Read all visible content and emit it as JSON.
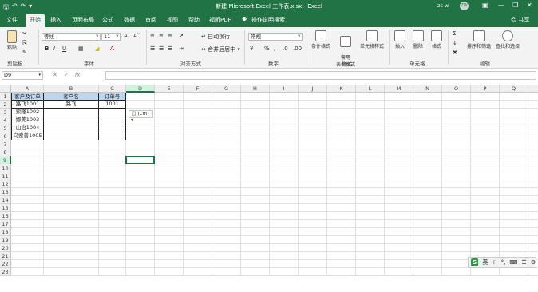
{
  "titlebar": {
    "doc_title": "新建 Microsoft Excel 工作表.xlsx  -  Excel",
    "user": "zc w",
    "avatar": "ZW",
    "qat": [
      "save-icon",
      "undo-icon",
      "redo-icon",
      "customize-icon"
    ],
    "controls": [
      "ribbon-display-icon",
      "minimize-icon",
      "restore-icon",
      "close-icon"
    ]
  },
  "tabs": [
    {
      "label": "文件",
      "active": false
    },
    {
      "label": "开始",
      "active": true
    },
    {
      "label": "插入",
      "active": false
    },
    {
      "label": "页面布局",
      "active": false
    },
    {
      "label": "公式",
      "active": false
    },
    {
      "label": "数据",
      "active": false
    },
    {
      "label": "审阅",
      "active": false
    },
    {
      "label": "视图",
      "active": false
    },
    {
      "label": "帮助",
      "active": false
    },
    {
      "label": "福昕PDF",
      "active": false
    }
  ],
  "tell_me": "操作说明搜索",
  "share": "共享",
  "ribbon": {
    "groups": [
      "剪贴板",
      "字体",
      "对齐方式",
      "数字",
      "样式",
      "单元格",
      "编辑"
    ],
    "paste": "粘贴",
    "font_name": "等线",
    "font_size": "11",
    "wrap_text": "自动换行",
    "merge_center": "合并后居中",
    "number_format": "常规",
    "conditional_format": "条件格式",
    "format_as_table": "套用\n表格格式",
    "cell_styles": "单元格样式",
    "insert": "插入",
    "delete": "删除",
    "format": "格式",
    "sort_filter": "排序和筛选",
    "find_select": "查找和选择"
  },
  "formula_bar": {
    "name_box": "D9",
    "fx": "fx",
    "value": ""
  },
  "sheet": {
    "columns": [
      "A",
      "B",
      "C",
      "D",
      "E",
      "F",
      "G",
      "H",
      "I",
      "J",
      "K",
      "L",
      "M",
      "N",
      "O",
      "P",
      "Q",
      "R"
    ],
    "rows": [
      "1",
      "2",
      "3",
      "4",
      "5",
      "6",
      "7",
      "8",
      "9",
      "10",
      "11",
      "12",
      "13",
      "14",
      "15",
      "16",
      "17",
      "18",
      "19",
      "20",
      "21",
      "22",
      "23"
    ],
    "selected_col": "D",
    "selected_row": "9",
    "headers": [
      "客户及订单",
      "客户名",
      "订单号"
    ],
    "data": [
      [
        "路飞1001",
        "路飞",
        "1001"
      ],
      [
        "索隆1002",
        "",
        ""
      ],
      [
        "娜美1003",
        "",
        ""
      ],
      [
        "山治1004",
        "",
        ""
      ],
      [
        "乌索普1005",
        "",
        ""
      ]
    ],
    "header_fill": "#bdd7ee",
    "paste_options": "(Ctrl)"
  },
  "ime": {
    "label": "英"
  },
  "colors": {
    "accent": "#217346"
  }
}
